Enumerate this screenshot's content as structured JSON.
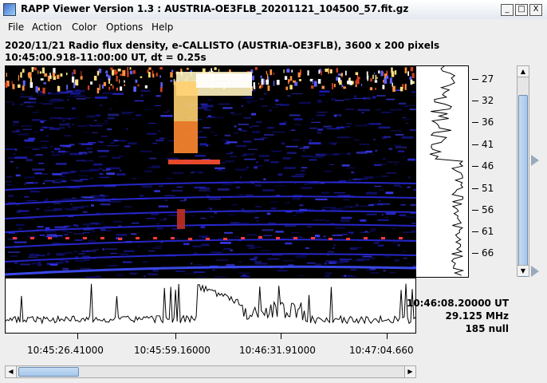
{
  "window": {
    "title": "RAPP Viewer Version 1.3 : AUSTRIA-OE3FLB_20201121_104500_57.fit.gz",
    "controls": [
      "_",
      "□",
      "X"
    ]
  },
  "menu": [
    "File",
    "Action",
    "Color",
    "Options",
    "Help"
  ],
  "header": {
    "line1": "2020/11/21  Radio flux density, e-CALLISTO (AUSTRIA-OE3FLB),  3600 x 200 pixels",
    "line2": "10:45:00.918-11:00:00 UT,  dt = 0.25s"
  },
  "freq_axis": [
    "27",
    "32",
    "36",
    "41",
    "46",
    "51",
    "56",
    "61",
    "66"
  ],
  "time_axis": [
    "10:45:26.41000",
    "10:45:59.16000",
    "10:46:31.91000",
    "10:47:04.660"
  ],
  "readout": {
    "time": "10:46:08.20000 UT",
    "freq": "29.125 MHz",
    "value": "185 null"
  },
  "icons": {
    "app": "rapp-viewer-icon",
    "scroll_up": "arrow-up-icon",
    "scroll_down": "arrow-down-icon",
    "scroll_left": "arrow-left-icon",
    "scroll_right": "arrow-right-icon"
  },
  "colors": {
    "background": "#000000",
    "band_blue": "#2020d0",
    "burst_hot": "#fff4c0",
    "burst_orange": "#ff8020"
  }
}
